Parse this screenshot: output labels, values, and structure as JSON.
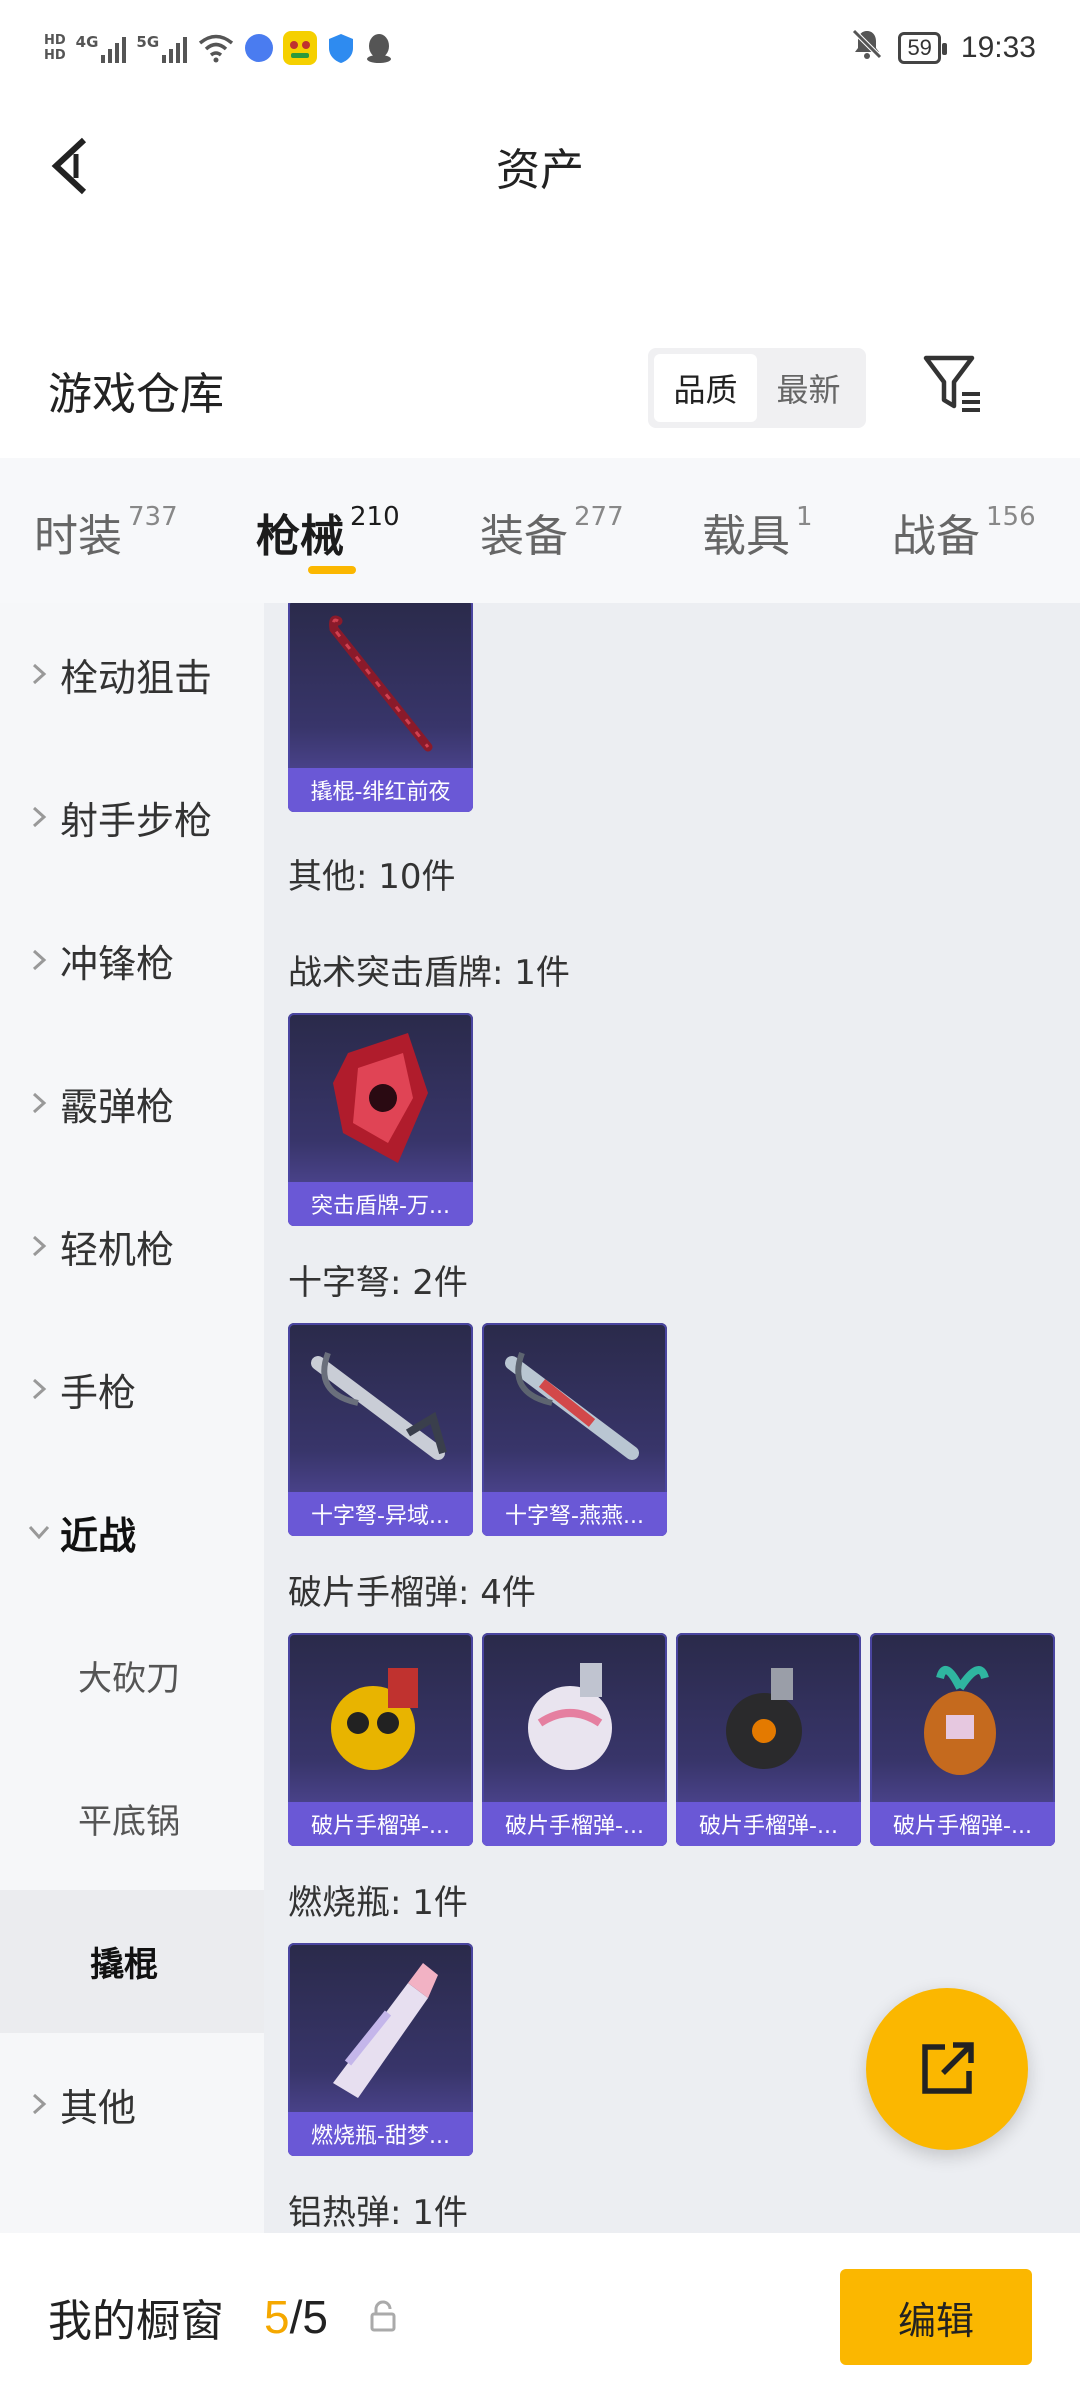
{
  "status_bar": {
    "network_left": "HD",
    "network_left2": "HD",
    "sig1": "4G",
    "sig2": "5G",
    "battery": "59",
    "time": "19:33"
  },
  "header": {
    "title": "资产"
  },
  "warehouse": {
    "title": "游戏仓库",
    "sort_options": [
      "品质",
      "最新"
    ]
  },
  "tabs": [
    {
      "label": "时装",
      "count": "737"
    },
    {
      "label": "枪械",
      "count": "210"
    },
    {
      "label": "装备",
      "count": "277"
    },
    {
      "label": "载具",
      "count": "1"
    },
    {
      "label": "战备",
      "count": "156"
    }
  ],
  "subnav": [
    {
      "label": "栓动狙击"
    },
    {
      "label": "射手步枪"
    },
    {
      "label": "冲锋枪"
    },
    {
      "label": "霰弹枪"
    },
    {
      "label": "轻机枪"
    },
    {
      "label": "手枪"
    },
    {
      "label": "近战"
    },
    {
      "label": "大砍刀"
    },
    {
      "label": "平底锅"
    },
    {
      "label": "撬棍"
    },
    {
      "label": "其他"
    }
  ],
  "content": {
    "top_card": "撬棍-绯红前夜",
    "groups": [
      {
        "label": "其他: 10件"
      },
      {
        "label": "战术突击盾牌: 1件",
        "cards": [
          "突击盾牌-万..."
        ]
      },
      {
        "label": "十字弩: 2件",
        "cards": [
          "十字弩-异域...",
          "十字弩-燕燕..."
        ]
      },
      {
        "label": "破片手榴弹: 4件",
        "cards": [
          "破片手榴弹-...",
          "破片手榴弹-...",
          "破片手榴弹-...",
          "破片手榴弹-..."
        ]
      },
      {
        "label": "燃烧瓶: 1件",
        "cards": [
          "燃烧瓶-甜梦..."
        ]
      },
      {
        "label": "铝热弹: 1件"
      }
    ]
  },
  "bottom_bar": {
    "label": "我的橱窗",
    "current": "5",
    "separator": "/",
    "total": "5",
    "edit_label": "编辑"
  },
  "colors": {
    "accent": "#fbb700",
    "card_caption": "#6a58d6"
  }
}
